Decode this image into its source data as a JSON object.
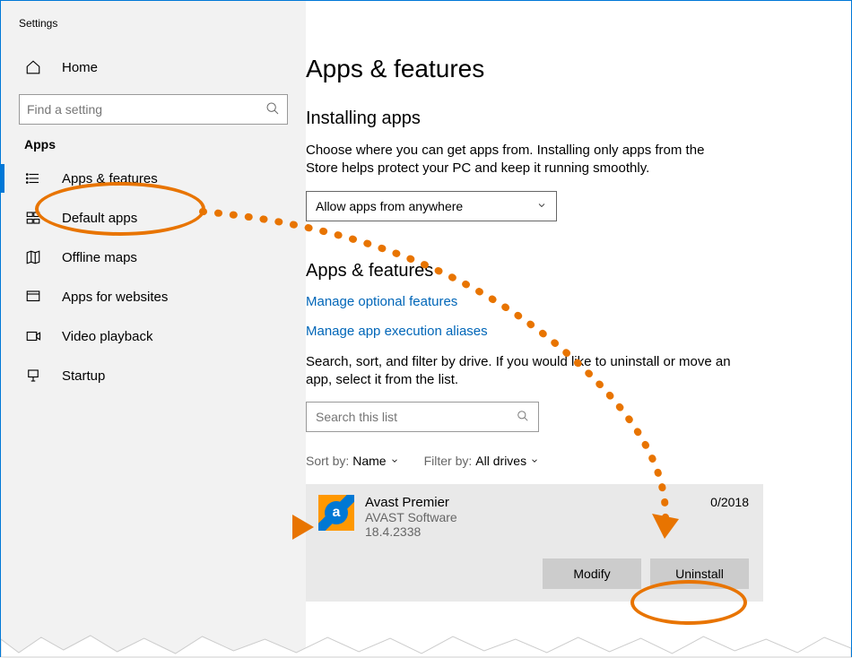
{
  "window_title": "Settings",
  "sidebar": {
    "home_label": "Home",
    "search_placeholder": "Find a setting",
    "section_label": "Apps",
    "items": [
      {
        "label": "Apps & features"
      },
      {
        "label": "Default apps"
      },
      {
        "label": "Offline maps"
      },
      {
        "label": "Apps for websites"
      },
      {
        "label": "Video playback"
      },
      {
        "label": "Startup"
      }
    ]
  },
  "main": {
    "page_title": "Apps & features",
    "installing_heading": "Installing apps",
    "installing_desc": "Choose where you can get apps from. Installing only apps from the Store helps protect your PC and keep it running smoothly.",
    "install_dropdown_value": "Allow apps from anywhere",
    "apps_heading": "Apps & features",
    "link_optional": "Manage optional features",
    "link_aliases": "Manage app execution aliases",
    "filter_desc": "Search, sort, and filter by drive. If you would like to uninstall or move an app, select it from the list.",
    "search_list_placeholder": "Search this list",
    "sort_by_label": "Sort by:",
    "sort_by_value": "Name",
    "filter_by_label": "Filter by:",
    "filter_by_value": "All drives",
    "app": {
      "name": "Avast Premier",
      "publisher": "AVAST Software",
      "version": "18.4.2338",
      "date": "0/2018"
    },
    "modify_label": "Modify",
    "uninstall_label": "Uninstall"
  },
  "colors": {
    "accent": "#0078d7",
    "annotation": "#e87400"
  }
}
